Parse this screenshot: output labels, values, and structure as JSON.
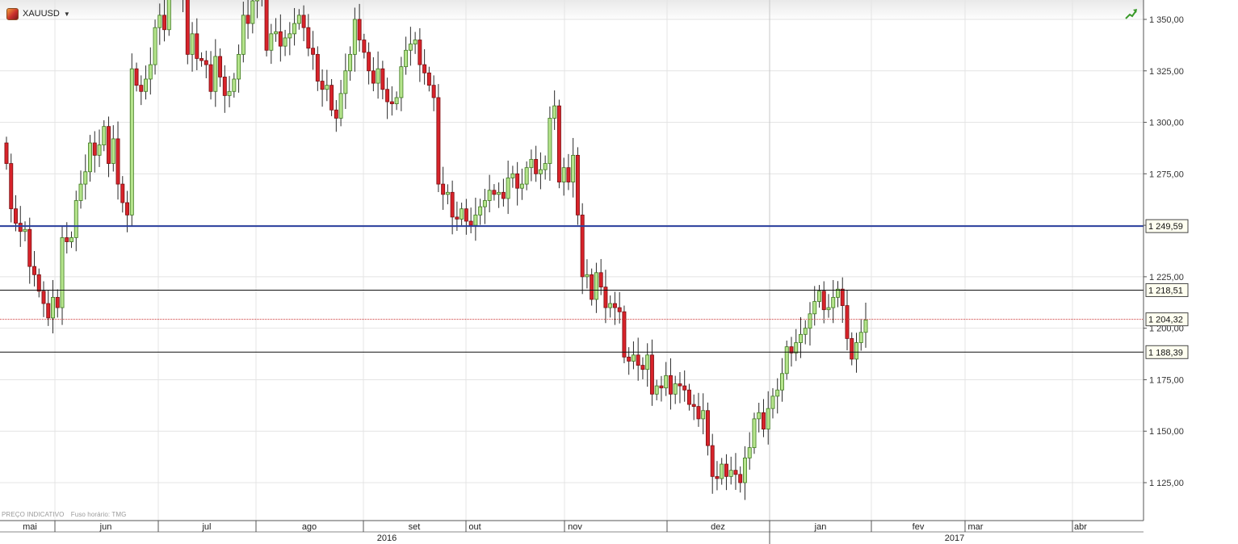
{
  "header": {
    "symbol": "XAUUSD",
    "symbol_icon": "gold-commodity-icon",
    "dropdown_icon": "caret-down-icon",
    "trend_icon": "trend-up-arrow-icon"
  },
  "footer": {
    "price_note": "PREÇO INDICATIVO",
    "timezone_note": "Fuso horário: TMG"
  },
  "colors": {
    "up_fill": "#b5e48c",
    "up_border": "#3e7a1e",
    "down_fill": "#d8232a",
    "down_border": "#7a0f12",
    "wick": "#2a2a2a",
    "blue_line": "#2a3f9e",
    "black_line": "#111111",
    "current_line": "#cc3333",
    "grid": "#e4e4e4"
  },
  "chart_data": {
    "type": "candlestick",
    "instrument": "XAUUSD",
    "ylim": [
      1105,
      1362
    ],
    "yticks": [
      1125,
      1150,
      1175,
      1200,
      1225,
      1250,
      1275,
      1300,
      1325,
      1350
    ],
    "ytick_labels": [
      "1 125,00",
      "1 150,00",
      "1 175,00",
      "1 200,00",
      "1 225,00",
      "1 250,00",
      "1 275,00",
      "1 300,00",
      "1 325,00",
      "1 350,00"
    ],
    "month_labels": [
      "mai",
      "jun",
      "jul",
      "ago",
      "set",
      "out",
      "nov",
      "dez",
      "jan",
      "fev",
      "mar",
      "abr"
    ],
    "year_labels": [
      "2016",
      "2017"
    ],
    "horizontal_lines": [
      {
        "value": 1249.59,
        "label": "1 249,59",
        "style": "solid-blue"
      },
      {
        "value": 1218.51,
        "label": "1 218,51",
        "style": "solid-black"
      },
      {
        "value": 1204.32,
        "label": "1 204,32",
        "style": "dotted-red"
      },
      {
        "value": 1188.39,
        "label": "1 188,39",
        "style": "solid-black"
      }
    ],
    "grid": true,
    "close": [
      1280,
      1258,
      1251,
      1247,
      1248,
      1230,
      1226,
      1218,
      1212,
      1205,
      1215,
      1210,
      1244,
      1242,
      1244,
      1262,
      1270,
      1276,
      1290,
      1284,
      1289,
      1298,
      1280,
      1292,
      1270,
      1261,
      1255,
      1326,
      1318,
      1315,
      1321,
      1328,
      1346,
      1352,
      1345,
      1366,
      1368,
      1366,
      1361,
      1333,
      1343,
      1331,
      1330,
      1328,
      1315,
      1332,
      1322,
      1313,
      1315,
      1321,
      1333,
      1352,
      1348,
      1359,
      1362,
      1362,
      1335,
      1343,
      1344,
      1337,
      1341,
      1343,
      1348,
      1352,
      1346,
      1336,
      1333,
      1320,
      1316,
      1318,
      1306,
      1302,
      1314,
      1325,
      1333,
      1350,
      1340,
      1334,
      1325,
      1319,
      1326,
      1316,
      1310,
      1309,
      1312,
      1327,
      1335,
      1338,
      1340,
      1328,
      1324,
      1318,
      1312,
      1270,
      1265,
      1266,
      1254,
      1253,
      1258,
      1252,
      1250,
      1255,
      1259,
      1262,
      1267,
      1265,
      1266,
      1263,
      1273,
      1275,
      1268,
      1270,
      1278,
      1282,
      1275,
      1277,
      1280,
      1302,
      1308,
      1271,
      1278,
      1271,
      1284,
      1255,
      1225,
      1226,
      1214,
      1227,
      1220,
      1210,
      1212,
      1210,
      1208,
      1186,
      1184,
      1187,
      1182,
      1180,
      1187,
      1168,
      1172,
      1171,
      1177,
      1168,
      1173,
      1172,
      1170,
      1163,
      1162,
      1156,
      1160,
      1143,
      1128,
      1127,
      1134,
      1128,
      1131,
      1129,
      1125,
      1137,
      1142,
      1156,
      1159,
      1151,
      1161,
      1167,
      1170,
      1178,
      1191,
      1188,
      1193,
      1197,
      1200,
      1207,
      1213,
      1218,
      1209,
      1210,
      1215,
      1219,
      1211,
      1195,
      1185,
      1193,
      1198,
      1204
    ]
  }
}
